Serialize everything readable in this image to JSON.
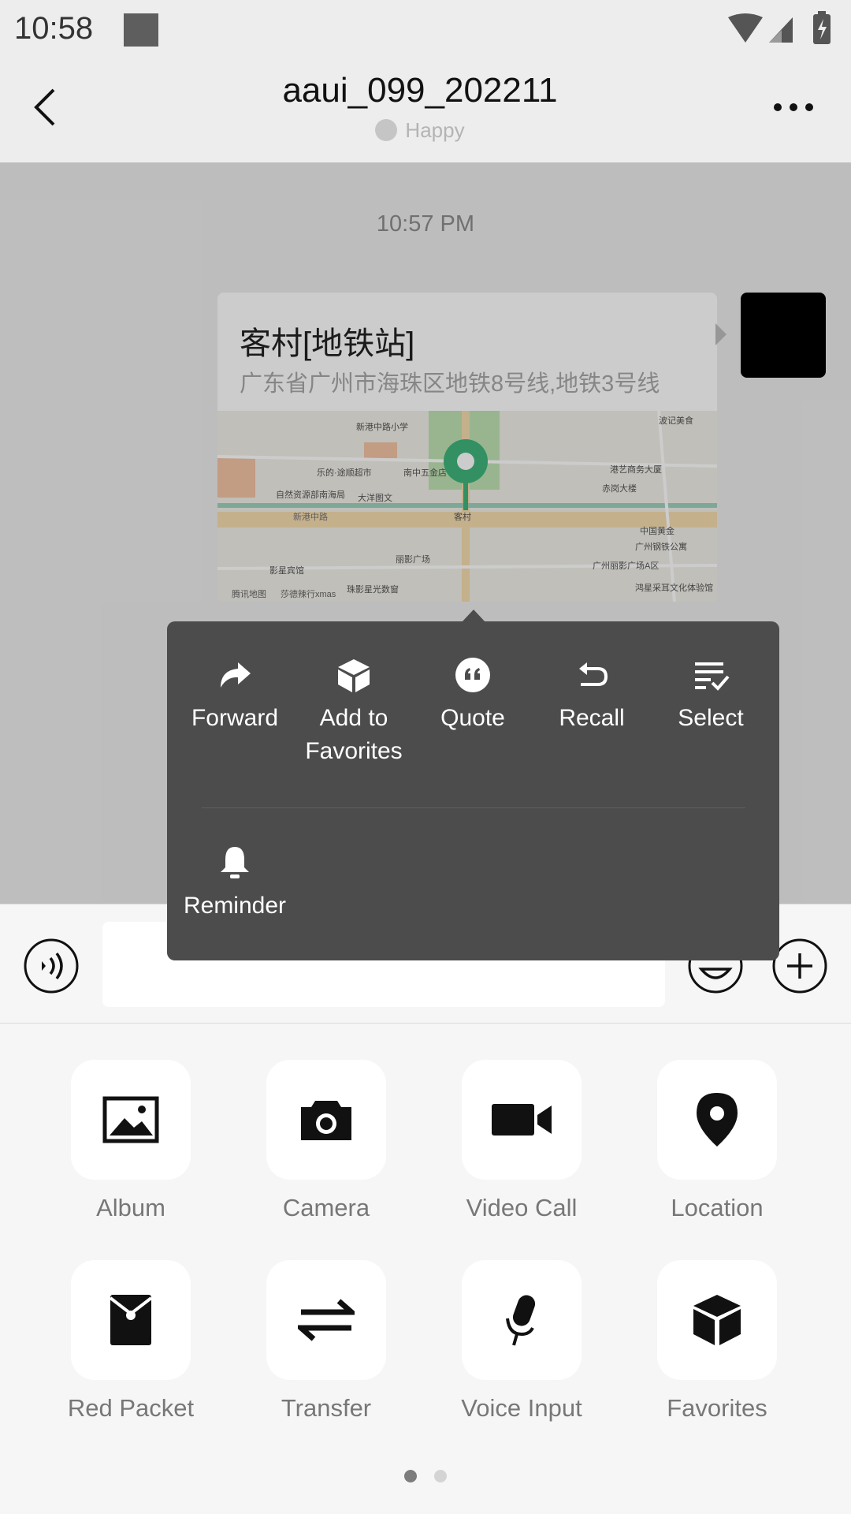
{
  "status_bar": {
    "time": "10:58"
  },
  "header": {
    "title": "aaui_099_202211",
    "status": "Happy"
  },
  "chat": {
    "timestamp": "10:57 PM",
    "location": {
      "name": "客村[地铁站]",
      "address": "广东省广州市海珠区地铁8号线,地铁3号线",
      "map_labels": [
        "新港中路小学",
        "乐的·途顺超市",
        "南中五金店",
        "自然资源部南海局",
        "大洋图文",
        "新港中路",
        "客村",
        "丽影广场",
        "影星宾馆",
        "波记美食",
        "港艺商务大厦",
        "赤岗大楼",
        "中国黄金",
        "广州丽影广场A区",
        "广州钢铁公寓",
        "鸿星采耳文化体验馆",
        "腾讯地图",
        "莎德辣行xmas",
        "珠影星光数窗"
      ]
    }
  },
  "context_menu": {
    "items": [
      {
        "label": "Forward",
        "icon": "forward-icon"
      },
      {
        "label": "Add to Favorites",
        "icon": "cube-icon"
      },
      {
        "label": "Quote",
        "icon": "quote-icon"
      },
      {
        "label": "Recall",
        "icon": "undo-icon"
      },
      {
        "label": "Select",
        "icon": "select-list-icon"
      },
      {
        "label": "Reminder",
        "icon": "bell-icon"
      }
    ]
  },
  "input_bar": {
    "value": "",
    "placeholder": ""
  },
  "panel": {
    "items": [
      {
        "label": "Album",
        "icon": "image-icon"
      },
      {
        "label": "Camera",
        "icon": "camera-icon"
      },
      {
        "label": "Video Call",
        "icon": "video-camera-icon"
      },
      {
        "label": "Location",
        "icon": "location-pin-icon"
      },
      {
        "label": "Red Packet",
        "icon": "red-packet-icon"
      },
      {
        "label": "Transfer",
        "icon": "transfer-icon"
      },
      {
        "label": "Voice Input",
        "icon": "microphone-icon"
      },
      {
        "label": "Favorites",
        "icon": "cube-icon"
      }
    ],
    "page_count": 2,
    "current_page": 1
  },
  "colors": {
    "background": "#ededed",
    "menu": "#4c4c4c",
    "map_pin": "#3fb47c",
    "panel": "#f6f6f6"
  }
}
